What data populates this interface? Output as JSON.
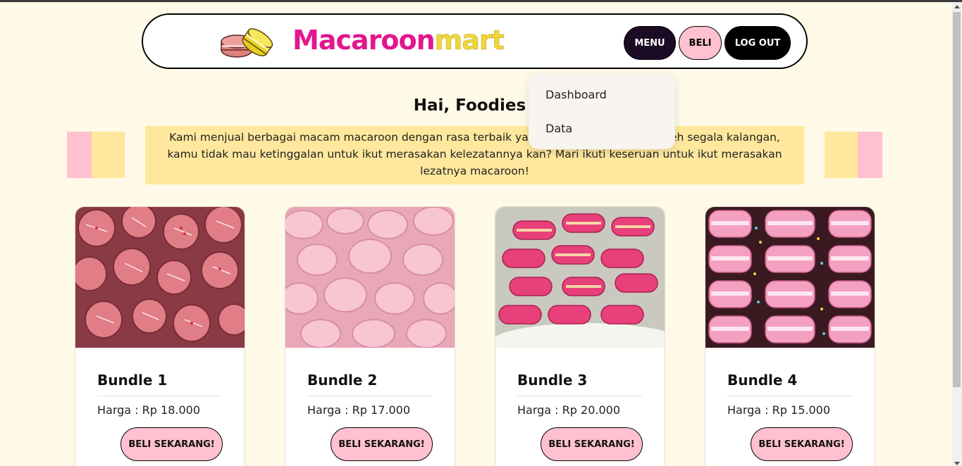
{
  "header": {
    "brand_part1": "Macaroon",
    "brand_part2": "mart",
    "nav": {
      "menu": "MENU",
      "beli": "BELI",
      "logout": "LOG OUT"
    }
  },
  "dropdown": {
    "items": [
      "Dashboard",
      "Data"
    ]
  },
  "greeting": "Hai, Foodies",
  "intro": "Kami menjual berbagai macam macaroon dengan rasa terbaik yang sudah pasti diminati oleh segala kalangan, kamu tidak mau ketinggalan untuk ikut merasakan kelezatannya kan? Mari ikuti keseruan untuk ikut merasakan lezatnya macaroon!",
  "products": [
    {
      "title": "Bundle 1",
      "price": "Harga : Rp 18.000",
      "button": "BELI SEKARANG!"
    },
    {
      "title": "Bundle 2",
      "price": "Harga : Rp 17.000",
      "button": "BELI SEKARANG!"
    },
    {
      "title": "Bundle 3",
      "price": "Harga : Rp 20.000",
      "button": "BELI SEKARANG!"
    },
    {
      "title": "Bundle 4",
      "price": "Harga : Rp 15.000",
      "button": "BELI SEKARANG!"
    }
  ],
  "colors": {
    "background": "#fffae8",
    "brand_pink": "#e2168f",
    "brand_yellow": "#f0d63a",
    "accent_pink": "#ffc0cf",
    "accent_yellow": "#ffe89d",
    "menu_dark": "#1c0b24"
  },
  "icons": {
    "logo": "macaron-logo-icon",
    "greeting": "girl-emoji-icon"
  }
}
